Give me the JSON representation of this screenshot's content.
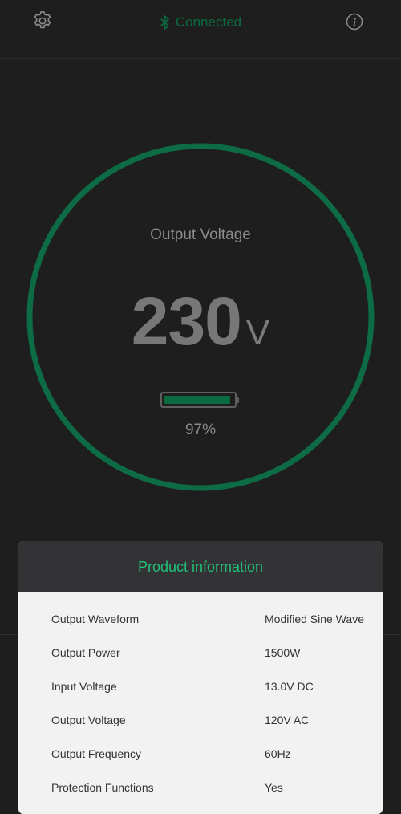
{
  "header": {
    "status_text": "Connected",
    "status_color": "#0b6b3f",
    "icons": [
      "gear-icon",
      "bluetooth-icon",
      "info-icon"
    ]
  },
  "gauge": {
    "label": "Output Voltage",
    "value": "230",
    "unit": "V",
    "ring_color": "#0d6b45",
    "battery_percent_text": "97%",
    "battery_level": 0.97,
    "battery_color": "#0b6b40"
  },
  "product_info": {
    "title": "Product information",
    "title_color": "#22c07a",
    "rows": [
      {
        "label": "Output Waveform",
        "value": "Modified Sine Wave"
      },
      {
        "label": "Output Power",
        "value": "1500W"
      },
      {
        "label": "Input Voltage",
        "value": "13.0V DC"
      },
      {
        "label": "Output Voltage",
        "value": "120V AC"
      },
      {
        "label": "Output Frequency",
        "value": "60Hz"
      },
      {
        "label": "Protection Functions",
        "value": "Yes"
      }
    ]
  }
}
